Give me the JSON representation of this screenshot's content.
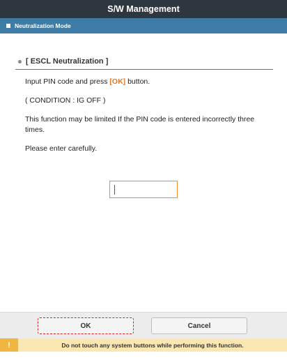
{
  "header": {
    "title": "S/W Management"
  },
  "mode": {
    "label": "Neutralization Mode"
  },
  "section": {
    "title": "[ ESCL Neutralization ]"
  },
  "instructions": {
    "line1_before": "Input PIN code and press ",
    "line1_ok": "[OK]",
    "line1_after": " button.",
    "condition": "( CONDITION : IG OFF )",
    "limit_warning": "This function may be limited If the PIN code is entered incorrectly three times.",
    "careful": "Please enter carefully."
  },
  "pin_input": {
    "value": "",
    "placeholder": ""
  },
  "buttons": {
    "ok": "OK",
    "cancel": "Cancel"
  },
  "warning": {
    "icon": "!",
    "text": "Do not touch any system buttons while performing this function."
  },
  "colors": {
    "title_bg": "#2e3740",
    "mode_bg": "#3e7ca6",
    "accent_orange": "#e87722",
    "warning_bg": "#fbe7b2",
    "warning_icon_bg": "#f1b63f",
    "ok_highlight": "#d42020"
  }
}
